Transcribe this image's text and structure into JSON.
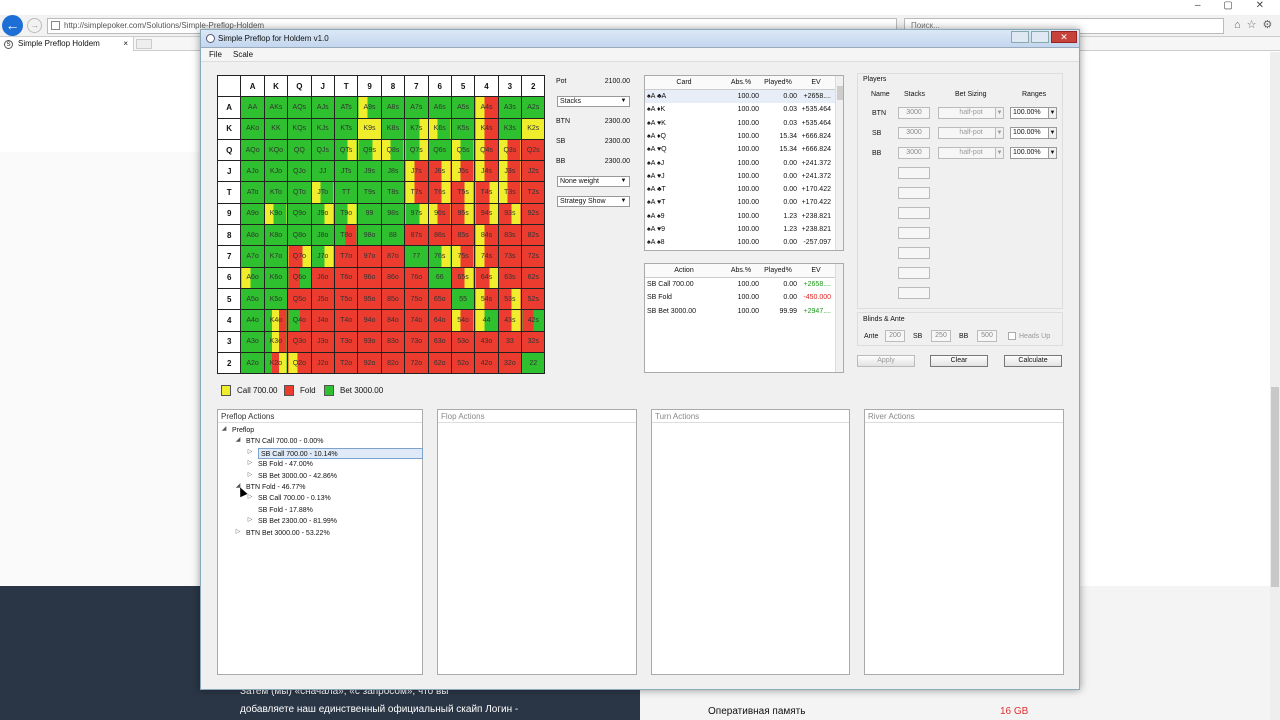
{
  "browser": {
    "url": "http://simplepoker.com/Solutions/Simple-Preflop-Holdem",
    "search_placeholder": "Поиск...",
    "tab_title": "Simple Preflop Holdem",
    "tab_close": "×",
    "back": "←",
    "forward": "→"
  },
  "page": {
    "bottom_text_1": "Затем (мы) «сначала», «с запросом», что вы",
    "bottom_text_2": "добавляете наш единственный официальный скайп Логин -",
    "ram_label": "Оперативная память",
    "ram_value": "16 GB"
  },
  "app": {
    "title": "Simple Preflop for Holdem v1.0",
    "close": "✕",
    "menu": [
      "File",
      "Scale"
    ]
  },
  "grid": {
    "columns": [
      "A",
      "K",
      "Q",
      "J",
      "T",
      "9",
      "8",
      "7",
      "6",
      "5",
      "4",
      "3",
      "2"
    ],
    "rows": [
      {
        "rank": "A",
        "cells": [
          "AA",
          "AKs",
          "AQs",
          "AJs",
          "ATs",
          "A9s",
          "A8s",
          "A7s",
          "A6s",
          "A5s",
          "A4s",
          "A3s",
          "A2s"
        ]
      },
      {
        "rank": "K",
        "cells": [
          "AKo",
          "KK",
          "KQs",
          "KJs",
          "KTs",
          "K9s",
          "K8s",
          "K7s",
          "K6s",
          "K5s",
          "K4s",
          "K3s",
          "K2s"
        ]
      },
      {
        "rank": "Q",
        "cells": [
          "AQo",
          "KQo",
          "QQ",
          "QJs",
          "QTs",
          "Q9s",
          "Q8s",
          "Q7s",
          "Q6s",
          "Q5s",
          "Q4s",
          "Q3s",
          "Q2s"
        ]
      },
      {
        "rank": "J",
        "cells": [
          "AJo",
          "KJo",
          "QJo",
          "JJ",
          "JTs",
          "J9s",
          "J8s",
          "J7s",
          "J6s",
          "J5s",
          "J4s",
          "J3s",
          "J2s"
        ]
      },
      {
        "rank": "T",
        "cells": [
          "ATo",
          "KTo",
          "QTo",
          "JTo",
          "TT",
          "T9s",
          "T8s",
          "T7s",
          "T6s",
          "T5s",
          "T4s",
          "T3s",
          "T2s"
        ]
      },
      {
        "rank": "9",
        "cells": [
          "A9o",
          "K9o",
          "Q9o",
          "J9o",
          "T9o",
          "99",
          "98s",
          "97s",
          "96s",
          "95s",
          "94s",
          "93s",
          "92s"
        ]
      },
      {
        "rank": "8",
        "cells": [
          "A8o",
          "K8o",
          "Q8o",
          "J8o",
          "T8o",
          "98o",
          "88",
          "87s",
          "86s",
          "85s",
          "84s",
          "83s",
          "82s"
        ]
      },
      {
        "rank": "7",
        "cells": [
          "A7o",
          "K7o",
          "Q7o",
          "J7o",
          "T7o",
          "97o",
          "87o",
          "77",
          "76s",
          "75s",
          "74s",
          "73s",
          "72s"
        ]
      },
      {
        "rank": "6",
        "cells": [
          "A6o",
          "K6o",
          "Q6o",
          "J6o",
          "T6o",
          "96o",
          "86o",
          "76o",
          "66",
          "65s",
          "64s",
          "63s",
          "62s"
        ]
      },
      {
        "rank": "5",
        "cells": [
          "A5o",
          "K5o",
          "Q5o",
          "J5o",
          "T5o",
          "95o",
          "85o",
          "75o",
          "65o",
          "55",
          "54s",
          "53s",
          "52s"
        ]
      },
      {
        "rank": "4",
        "cells": [
          "A4o",
          "K4o",
          "Q4o",
          "J4o",
          "T4o",
          "94o",
          "84o",
          "74o",
          "64o",
          "54o",
          "44",
          "43s",
          "42s"
        ]
      },
      {
        "rank": "3",
        "cells": [
          "A3o",
          "K3o",
          "Q3o",
          "J3o",
          "T3o",
          "93o",
          "83o",
          "73o",
          "63o",
          "53o",
          "43o",
          "33",
          "32s"
        ]
      },
      {
        "rank": "2",
        "cells": [
          "A2o",
          "K2o",
          "Q2o",
          "J2o",
          "T2o",
          "92o",
          "82o",
          "72o",
          "62o",
          "52o",
          "42o",
          "32o",
          "22"
        ]
      }
    ],
    "colors": [
      [
        "G",
        "G",
        "G",
        "G",
        "G",
        "YG",
        "G",
        "G",
        "G",
        "G",
        "YR",
        "G",
        "G"
      ],
      [
        "G",
        "G",
        "G",
        "G",
        "G",
        "Y",
        "G",
        "GY",
        "YG",
        "G",
        "YR",
        "G",
        "Y"
      ],
      [
        "G",
        "G",
        "G",
        "G",
        "GY",
        "GY",
        "YG",
        "GY",
        "G",
        "YG",
        "YR",
        "YR",
        "R"
      ],
      [
        "G",
        "G",
        "G",
        "G",
        "G",
        "G",
        "G",
        "YR",
        "RY",
        "YR",
        "YR",
        "YR",
        "R"
      ],
      [
        "G",
        "G",
        "G",
        "YG",
        "G",
        "G",
        "G",
        "YR",
        "RY",
        "RY",
        "RY",
        "YR",
        "R"
      ],
      [
        "G",
        "YG",
        "G",
        "GY",
        "GY",
        "G",
        "G",
        "GY",
        "YR",
        "RY",
        "RY",
        "RY",
        "R"
      ],
      [
        "G",
        "G",
        "G",
        "G",
        "GR",
        "G",
        "G",
        "R",
        "R",
        "R",
        "YR",
        "R",
        "R"
      ],
      [
        "G",
        "G",
        "RY",
        "GY",
        "R",
        "R",
        "R",
        "G",
        "GY",
        "YR",
        "YR",
        "R",
        "R"
      ],
      [
        "YG",
        "G",
        "RG",
        "R",
        "R",
        "R",
        "R",
        "R",
        "G",
        "RY",
        "RY",
        "R",
        "R"
      ],
      [
        "G",
        "G",
        "R",
        "R",
        "R",
        "R",
        "R",
        "R",
        "R",
        "G",
        "YR",
        "RY",
        "R"
      ],
      [
        "G",
        "GYR",
        "GR",
        "R",
        "R",
        "R",
        "R",
        "R",
        "R",
        "YR",
        "YG",
        "RY",
        "RG"
      ],
      [
        "G",
        "GYR",
        "R",
        "R",
        "R",
        "R",
        "R",
        "R",
        "R",
        "R",
        "R",
        "R",
        "R"
      ],
      [
        "G",
        "GRY",
        "YR",
        "R",
        "R",
        "R",
        "R",
        "R",
        "R",
        "R",
        "R",
        "R",
        "G"
      ]
    ]
  },
  "legend": [
    {
      "label": "Call 700.00",
      "color": "#f0ee2c"
    },
    {
      "label": "Fold",
      "color": "#ec3b2f"
    },
    {
      "label": "Bet 3000.00",
      "color": "#2fc02f"
    }
  ],
  "pot_panel": {
    "pot_label": "Pot",
    "pot_value": "2100.00",
    "stacks_combo": "Stacks",
    "btn_label": "BTN",
    "btn_value": "2300.00",
    "sb_label": "SB",
    "sb_value": "2300.00",
    "bb_label": "BB",
    "bb_value": "2300.00",
    "weight_combo": "None weight",
    "strategy_combo": "Strategy Show",
    "combo_arrow": "▼"
  },
  "cards_table": {
    "headers": [
      "Card",
      "Abs.%",
      "Played%",
      "EV"
    ],
    "rows": [
      [
        "♠A ♣A",
        "100.00",
        "0.00",
        "+2658...."
      ],
      [
        "♠A ♦K",
        "100.00",
        "0.03",
        "+535.464"
      ],
      [
        "♠A ♥K",
        "100.00",
        "0.03",
        "+535.464"
      ],
      [
        "♠A ♦Q",
        "100.00",
        "15.34",
        "+666.824"
      ],
      [
        "♠A ♥Q",
        "100.00",
        "15.34",
        "+666.824"
      ],
      [
        "♠A ♠J",
        "100.00",
        "0.00",
        "+241.372"
      ],
      [
        "♠A ♥J",
        "100.00",
        "0.00",
        "+241.372"
      ],
      [
        "♠A ♣T",
        "100.00",
        "0.00",
        "+170.422"
      ],
      [
        "♠A ♥T",
        "100.00",
        "0.00",
        "+170.422"
      ],
      [
        "♠A ♠9",
        "100.00",
        "1.23",
        "+238.821"
      ],
      [
        "♠A ♥9",
        "100.00",
        "1.23",
        "+238.821"
      ],
      [
        "♠A ♠8",
        "100.00",
        "0.00",
        "-257.097"
      ]
    ]
  },
  "action_table": {
    "headers": [
      "Action",
      "Abs.%",
      "Played%",
      "EV"
    ],
    "rows": [
      [
        "SB Call 700.00",
        "100.00",
        "0.00",
        "+2658...."
      ],
      [
        "SB Fold",
        "100.00",
        "0.00",
        "-450.000"
      ],
      [
        "SB Bet 3000.00",
        "100.00",
        "99.99",
        "+2947...."
      ]
    ]
  },
  "players": {
    "title": "Players",
    "headers": [
      "Name",
      "Stacks",
      "Bet Sizing",
      "Ranges"
    ],
    "rows": [
      {
        "name": "BTN",
        "stack": "3000",
        "sizing": "half-pot",
        "range": "100.00%"
      },
      {
        "name": "SB",
        "stack": "3000",
        "sizing": "half-pot",
        "range": "100.00%"
      },
      {
        "name": "BB",
        "stack": "3000",
        "sizing": "half-pot",
        "range": "100.00%"
      }
    ]
  },
  "blinds": {
    "title": "Blinds & Ante",
    "ante_label": "Ante",
    "ante": "200",
    "sb_label": "SB",
    "sb": "250",
    "bb_label": "BB",
    "bb": "500",
    "heads_up": "Heads Up"
  },
  "buttons": {
    "apply": "Apply",
    "clear": "Clear",
    "calculate": "Calculate"
  },
  "panels": {
    "preflop": "Preflop Actions",
    "flop": "Flop Actions",
    "turn": "Turn Actions",
    "river": "River Actions"
  },
  "tree": [
    {
      "text": "Preflop",
      "glyph": "◢"
    },
    {
      "text": "BTN Call 700.00 - 0.00%",
      "glyph": "◢"
    },
    {
      "text": "SB Call 700.00 - 10.14%",
      "glyph": "▷"
    },
    {
      "text": "SB Fold - 47.00%",
      "glyph": "▷"
    },
    {
      "text": "SB Bet 3000.00 - 42.86%",
      "glyph": "▷"
    },
    {
      "text": "BTN Fold - 46.77%",
      "glyph": "◢"
    },
    {
      "text": "SB Call 700.00 - 0.13%",
      "glyph": "▷"
    },
    {
      "text": "SB Fold - 17.88%",
      "glyph": ""
    },
    {
      "text": "SB Bet 2300.00 - 81.99%",
      "glyph": "▷"
    },
    {
      "text": "BTN Bet 3000.00 - 53.22%",
      "glyph": "▷"
    }
  ]
}
